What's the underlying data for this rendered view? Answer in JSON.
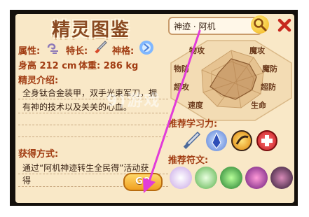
{
  "title": "精灵图鉴",
  "search": {
    "value": "神迹 · 阿机"
  },
  "info": {
    "attr_label": "属性:",
    "special_label": "特长:",
    "godhood_label": "神格:",
    "height": "身高 212 cm",
    "weight": "体重: 286 kg"
  },
  "intro": {
    "label": "精灵介绍:",
    "line1": "全身钛合金装甲，双手光束军刀，拥",
    "line2": "有神的技术以及关关的心血。"
  },
  "obtain": {
    "label": "获得方式:",
    "line1": "通过“阿机神迹转生全民得”活动获",
    "line2": "得",
    "go_label": "GO"
  },
  "stats": {
    "labels": [
      "物攻",
      "魔攻",
      "魔防",
      "超防",
      "生命",
      "速度",
      "超攻",
      "物防"
    ]
  },
  "skills": {
    "label": "推荐学习力:",
    "icons": [
      "sword-skill-icon",
      "crystal-skill-icon",
      "slash-skill-icon",
      "cross-skill-icon"
    ]
  },
  "runes": {
    "label": "推荐符文:",
    "icons": [
      "white-rune-icon",
      "green-rune-icon",
      "green-spiral-rune-icon",
      "purple-rune-icon",
      "dark-rune-icon"
    ]
  },
  "watermark": "9)游戏",
  "colors": {
    "label": "#a13c12",
    "title": "#8a4a22",
    "panel": "#f9e8c7",
    "arrow": "#e23cd8"
  }
}
